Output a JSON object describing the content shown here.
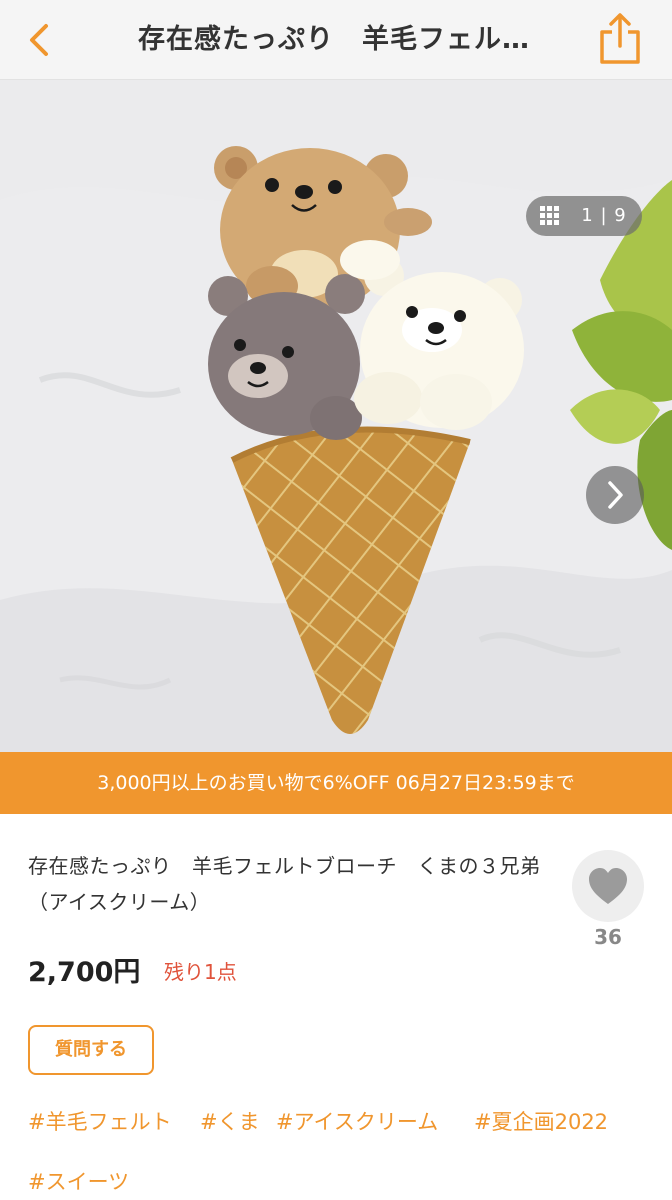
{
  "header": {
    "title": "存在感たっぷり　羊毛フェル…",
    "back_icon": "chevron-left-icon",
    "share_icon": "share-icon"
  },
  "gallery": {
    "counter": "1 | 9",
    "grid_icon": "grid-icon",
    "next_icon": "chevron-right-icon"
  },
  "promo": {
    "text": "3,000円以上のお買い物で6%OFF 06月27日23:59まで"
  },
  "product": {
    "title": "存在感たっぷり　羊毛フェルトブローチ　くまの３兄弟（アイスクリーム）",
    "price": "2,700円",
    "stock": "残り1点",
    "favorites": "36",
    "ask_button": "質問する"
  },
  "tags": [
    "#羊毛フェルト",
    "#くま",
    "#アイスクリーム",
    "#夏企画2022",
    "#スイーツ"
  ],
  "colors": {
    "accent": "#f0962e",
    "stock_red": "#e0533b",
    "header_bg": "#f5f5f5"
  }
}
